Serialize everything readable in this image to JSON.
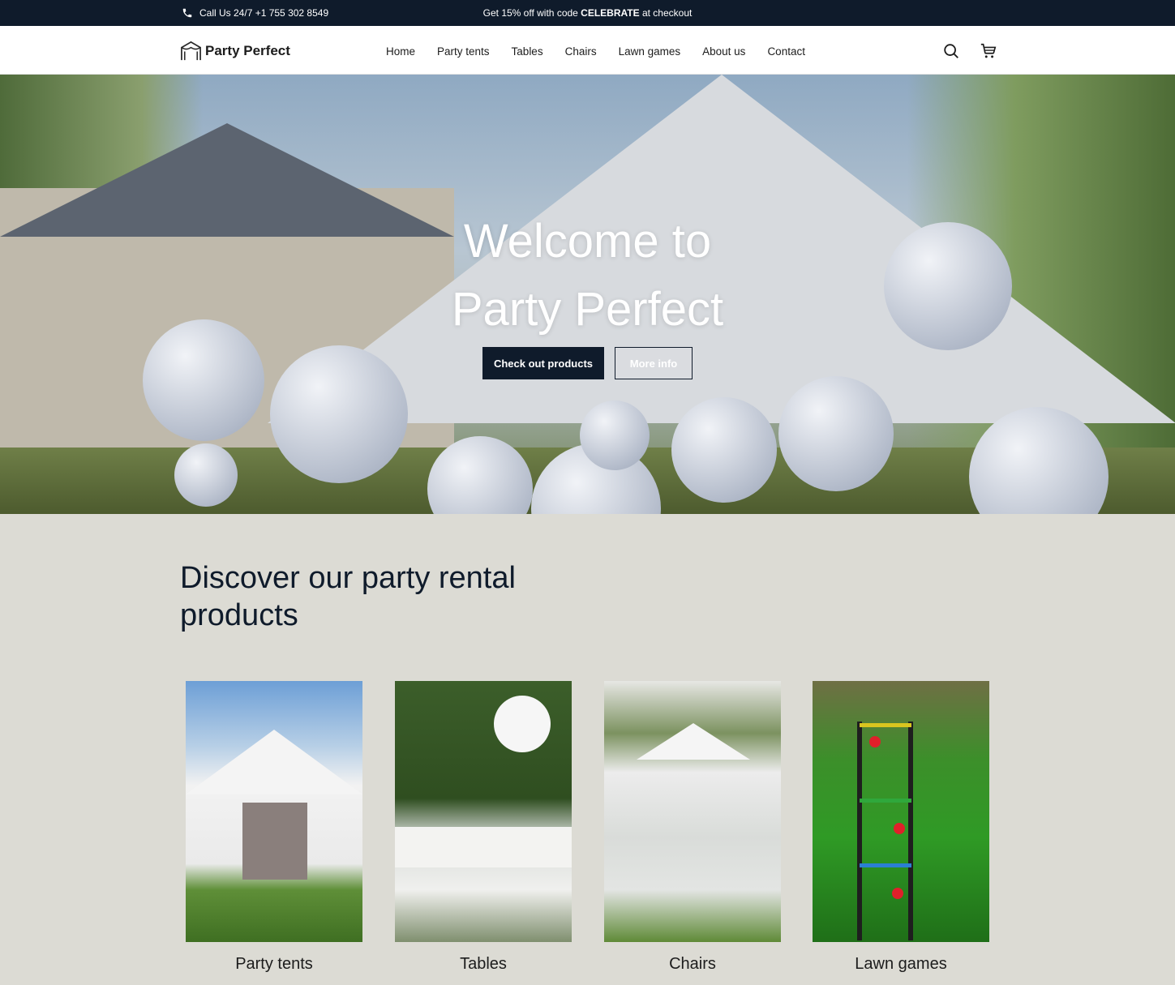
{
  "announcement": {
    "phone_text": "Call Us 24/7 +1 755 302 8549",
    "promo_prefix": "Get 15% off with code ",
    "promo_code": "CELEBRATE",
    "promo_suffix": " at checkout"
  },
  "header": {
    "brand": "Party Perfect",
    "nav": [
      "Home",
      "Party tents",
      "Tables",
      "Chairs",
      "Lawn games",
      "About us",
      "Contact"
    ]
  },
  "hero": {
    "title_line1": "Welcome to",
    "title_line2": "Party Perfect",
    "primary_button": "Check out products",
    "secondary_button": "More info"
  },
  "products": {
    "title": "Discover our party rental products",
    "items": [
      {
        "label": "Party tents"
      },
      {
        "label": "Tables"
      },
      {
        "label": "Chairs"
      },
      {
        "label": "Lawn games"
      }
    ]
  },
  "colors": {
    "navy": "#0f1b2b",
    "section_bg": "#dcdbd4",
    "header_bg": "#ffffff"
  },
  "icons": [
    "phone-icon",
    "tent-logo-icon",
    "search-icon",
    "cart-icon"
  ]
}
